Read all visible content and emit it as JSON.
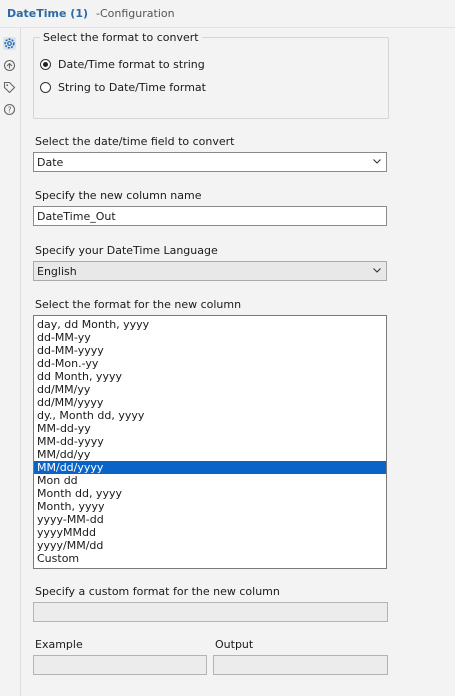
{
  "title": {
    "tool": "DateTime (1)",
    "section": "-Configuration"
  },
  "side_icons": [
    "gear-icon",
    "connection-icon",
    "tag-icon",
    "help-icon"
  ],
  "format_group": {
    "legend": "Select the format to convert",
    "options": [
      {
        "label": "Date/Time format to string",
        "checked": true
      },
      {
        "label": "String to Date/Time format",
        "checked": false
      }
    ]
  },
  "field_select": {
    "label": "Select the date/time field to convert",
    "value": "Date"
  },
  "new_column": {
    "label": "Specify the new column name",
    "value": "DateTime_Out"
  },
  "language": {
    "label": "Specify your DateTime Language",
    "value": "English"
  },
  "format_list": {
    "label": "Select the format for the new column",
    "selected": "MM/dd/yyyy",
    "items": [
      "day, dd Month, yyyy",
      "dd-MM-yy",
      "dd-MM-yyyy",
      "dd-Mon.-yy",
      "dd Month, yyyy",
      "dd/MM/yy",
      "dd/MM/yyyy",
      "dy., Month dd, yyyy",
      "MM-dd-yy",
      "MM-dd-yyyy",
      "MM/dd/yy",
      "MM/dd/yyyy",
      "Mon dd",
      "Month dd, yyyy",
      "Month, yyyy",
      "yyyy-MM-dd",
      "yyyyMMdd",
      "yyyy/MM/dd",
      "Custom"
    ]
  },
  "custom_format": {
    "label": "Specify a custom format for the new column",
    "value": ""
  },
  "example": {
    "label": "Example",
    "value": ""
  },
  "output": {
    "label": "Output",
    "value": ""
  },
  "colors": {
    "accent": "#0a64c8",
    "title": "#2b6aa8",
    "background": "#f3f3f3"
  }
}
